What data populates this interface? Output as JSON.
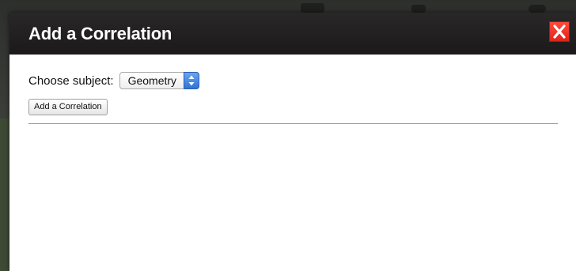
{
  "dialog": {
    "title": "Add a Correlation",
    "close_icon": "close-x-icon"
  },
  "form": {
    "subject_label": "Choose subject:",
    "subject_selected": "Geometry",
    "subject_select_icon": "up-down-arrows-icon",
    "add_button_label": "Add a Correlation"
  },
  "colors": {
    "header_bg": "#1b191a",
    "close_button": "#e0231a",
    "select_accent": "#2f72d6"
  }
}
